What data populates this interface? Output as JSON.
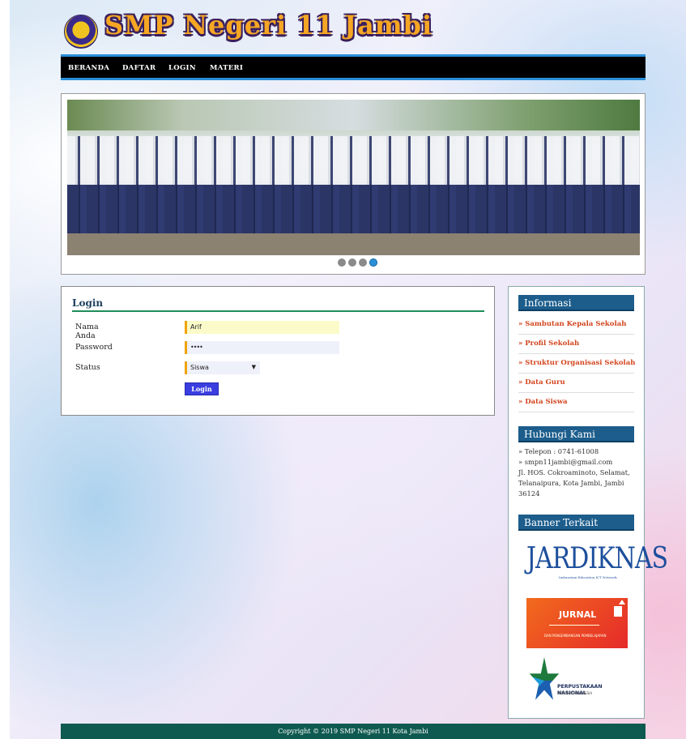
{
  "header": {
    "site_title": "SMP Negeri 11 Jambi",
    "logo_icon": "school-emblem-icon"
  },
  "nav": {
    "items": [
      "BERANDA",
      "DAFTAR",
      "LOGIN",
      "MATERI"
    ]
  },
  "slider": {
    "dots_total": 4,
    "active_dot": 4
  },
  "login": {
    "title": "Login",
    "fields": {
      "name_label": "Nama Anda",
      "name_value": "Arif",
      "password_label": "Password",
      "password_value": "••••",
      "status_label": "Status",
      "status_value": "Siswa"
    },
    "button_label": "Login"
  },
  "sidebar": {
    "info_title": "Informasi",
    "info_items": [
      "» Sambutan Kepala Sekolah",
      "» Profil Sekolah",
      "» Struktur Organisasi Sekolah",
      "» Data Guru",
      "» Data Siswa"
    ],
    "contact_title": "Hubungi Kami",
    "contact_phone": "» Telepon : 0741-61008",
    "contact_email": "» smpn11jambi@gmail.com",
    "contact_address": "Jl. HOS. Cokroaminoto, Selamat, Telanaipura, Kota Jambi, Jambi 36124",
    "banner_title": "Banner Terkait",
    "banners": {
      "jardiknas": "JARDIKNAS",
      "jardiknas_sub": "Indonesian Education ICT Network",
      "jurnal": "JURNAL",
      "jurnal_sub": "DAN PENGEMBANGAN PEMBELAJARAN",
      "perpus": "PERPUSTAKAAN NASIONAL",
      "perpus_sub": "REPUBLIK INDONESIA"
    }
  },
  "footer": {
    "text": "Copyright © 2019 SMP Negeri 11 Kota Jambi"
  },
  "colors": {
    "nav_bg": "#000000",
    "nav_border": "#2a8fd8",
    "side_head_bg": "#1c5d8c",
    "link_orange": "#d2451e",
    "footer_bg": "#0f5a50",
    "login_button": "#3a3ee0"
  }
}
